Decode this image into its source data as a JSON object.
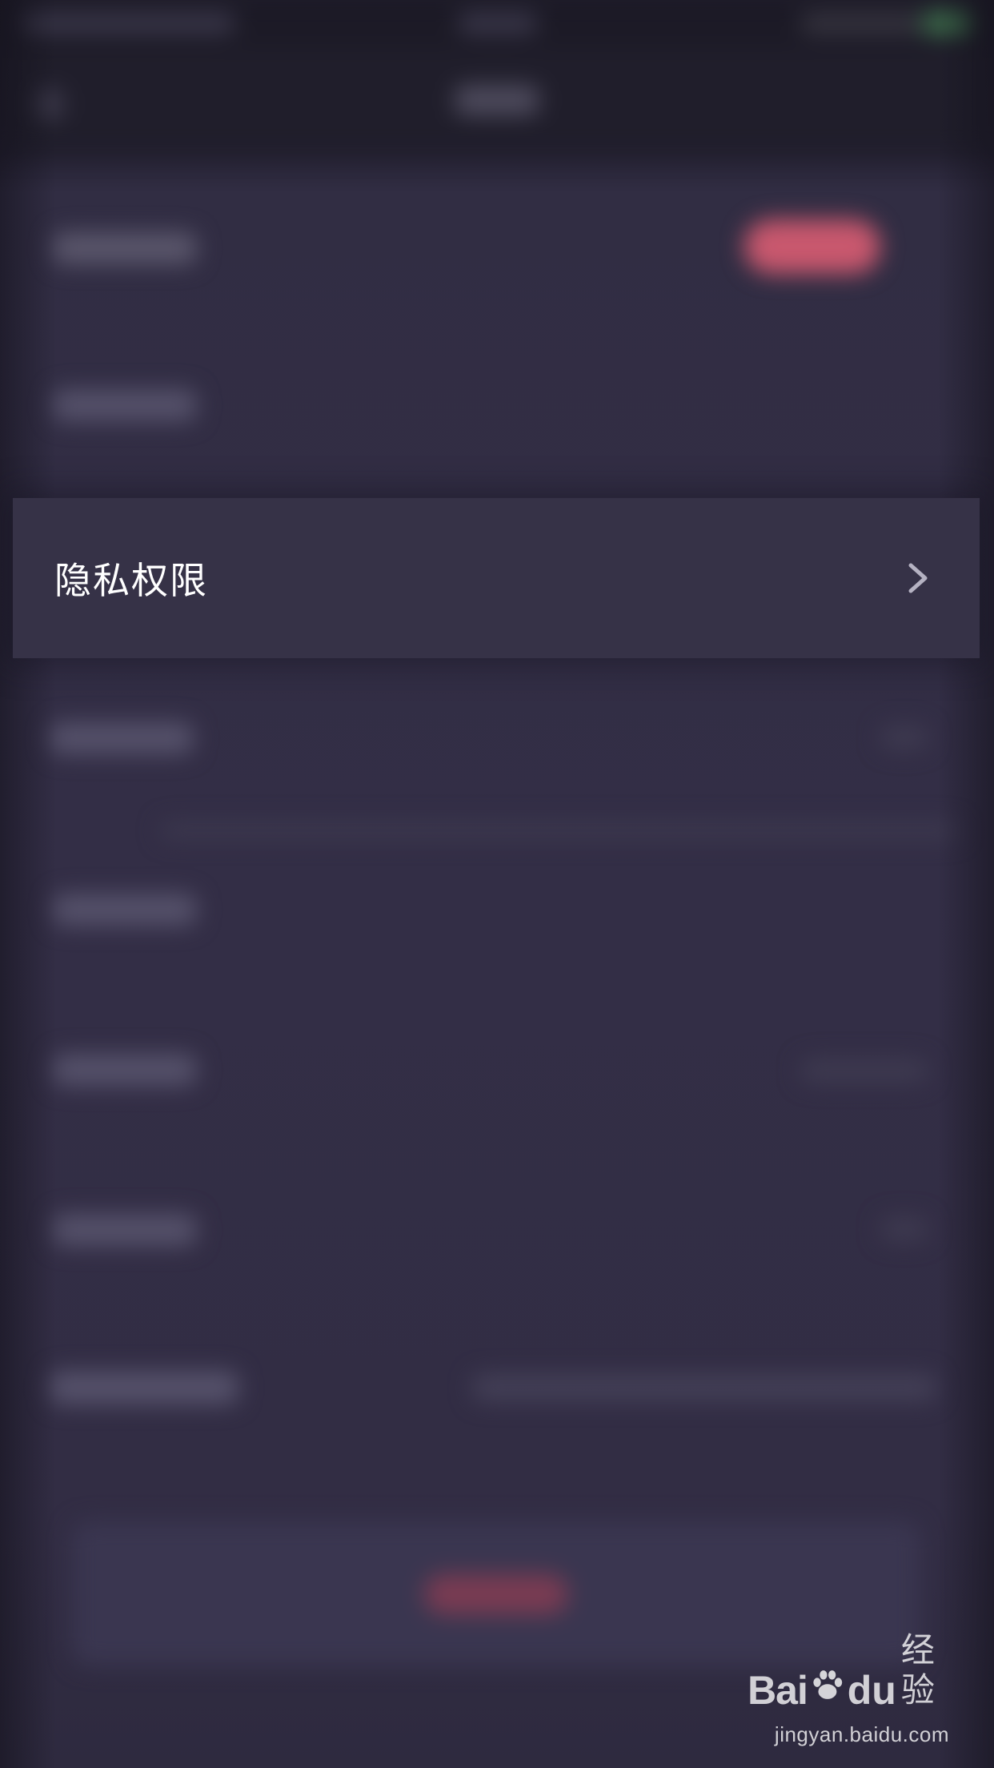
{
  "settings": {
    "highlighted_item": {
      "label": "隐私权限",
      "icon": "chevron-right-icon"
    }
  },
  "watermark": {
    "brand_bai": "Bai",
    "brand_du": "du",
    "brand_cn": "经验",
    "url": "jingyan.baidu.com",
    "icon": "paw-icon"
  },
  "colors": {
    "background": "#332e46",
    "row_highlight": "#363247",
    "accent_blurred": "#c9586e",
    "text": "#ffffff"
  }
}
